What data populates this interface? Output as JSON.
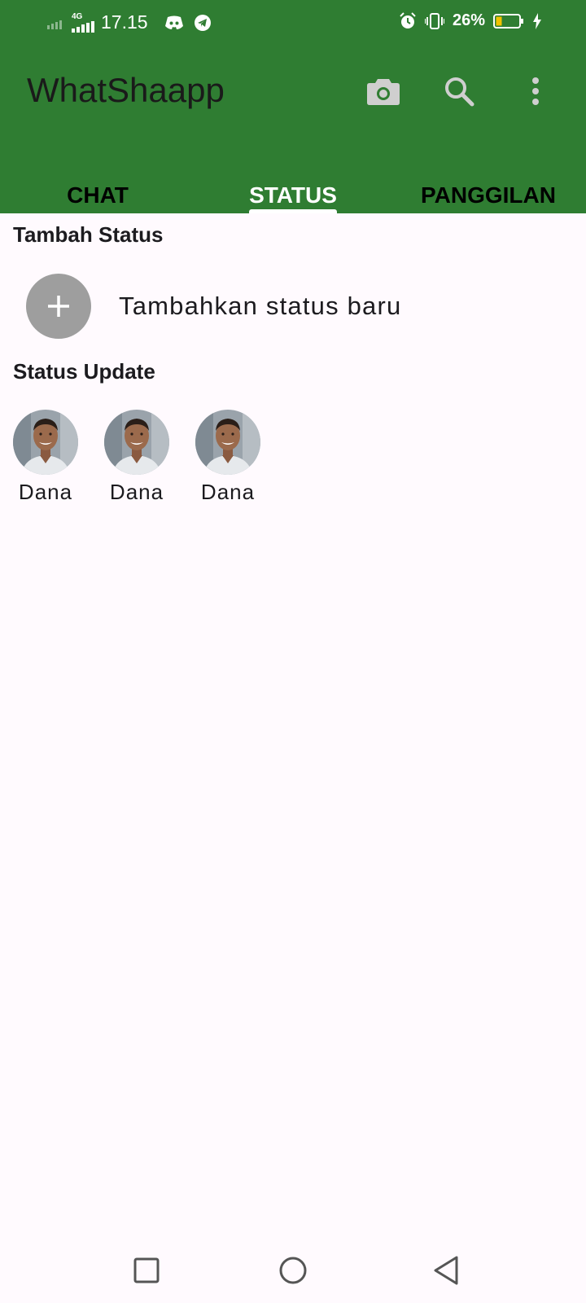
{
  "status_bar": {
    "network": "4G",
    "time": "17.15",
    "battery": "26%",
    "battery_level": 0.26
  },
  "app_bar": {
    "title": "WhatShaapp",
    "icons": [
      "camera-icon",
      "search-icon",
      "more-vert-icon"
    ]
  },
  "tabs": [
    {
      "label": "CHAT",
      "active": false
    },
    {
      "label": "STATUS",
      "active": true
    },
    {
      "label": "PANGGILAN",
      "active": false
    }
  ],
  "add_status": {
    "heading": "Tambah Status",
    "label": "Tambahkan status baru"
  },
  "status_updates": {
    "heading": "Status Update",
    "items": [
      {
        "name": "Dana"
      },
      {
        "name": "Dana"
      },
      {
        "name": "Dana"
      }
    ]
  },
  "nav": {
    "icons": [
      "recent-apps-icon",
      "home-icon",
      "back-icon"
    ]
  },
  "colors": {
    "app_bar": "#2f7d32",
    "background": "#fffafe",
    "add_circle": "#9e9e9e"
  }
}
